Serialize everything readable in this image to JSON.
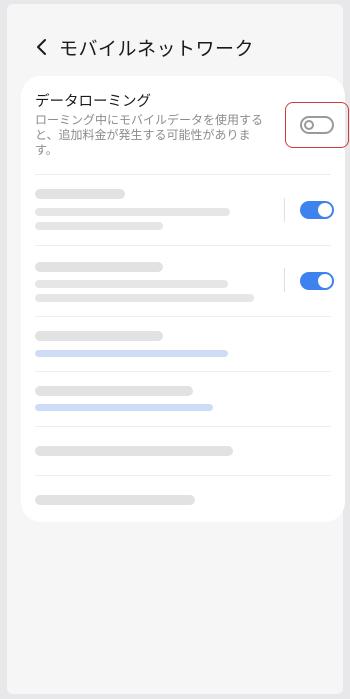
{
  "header": {
    "back_icon": "chevron-left-icon",
    "title": "モバイルネットワーク"
  },
  "roaming": {
    "title": "データローミング",
    "description": "ローミング中にモバイルデータを使用すると、追加料金が発生する可能性があります。",
    "toggle_on": false
  },
  "placeholder_rows": [
    {
      "toggle_on": true
    },
    {
      "toggle_on": true
    }
  ],
  "colors": {
    "accent": "#3e82f0",
    "highlight": "#d6383f",
    "link_placeholder": "#cfdcf7"
  }
}
